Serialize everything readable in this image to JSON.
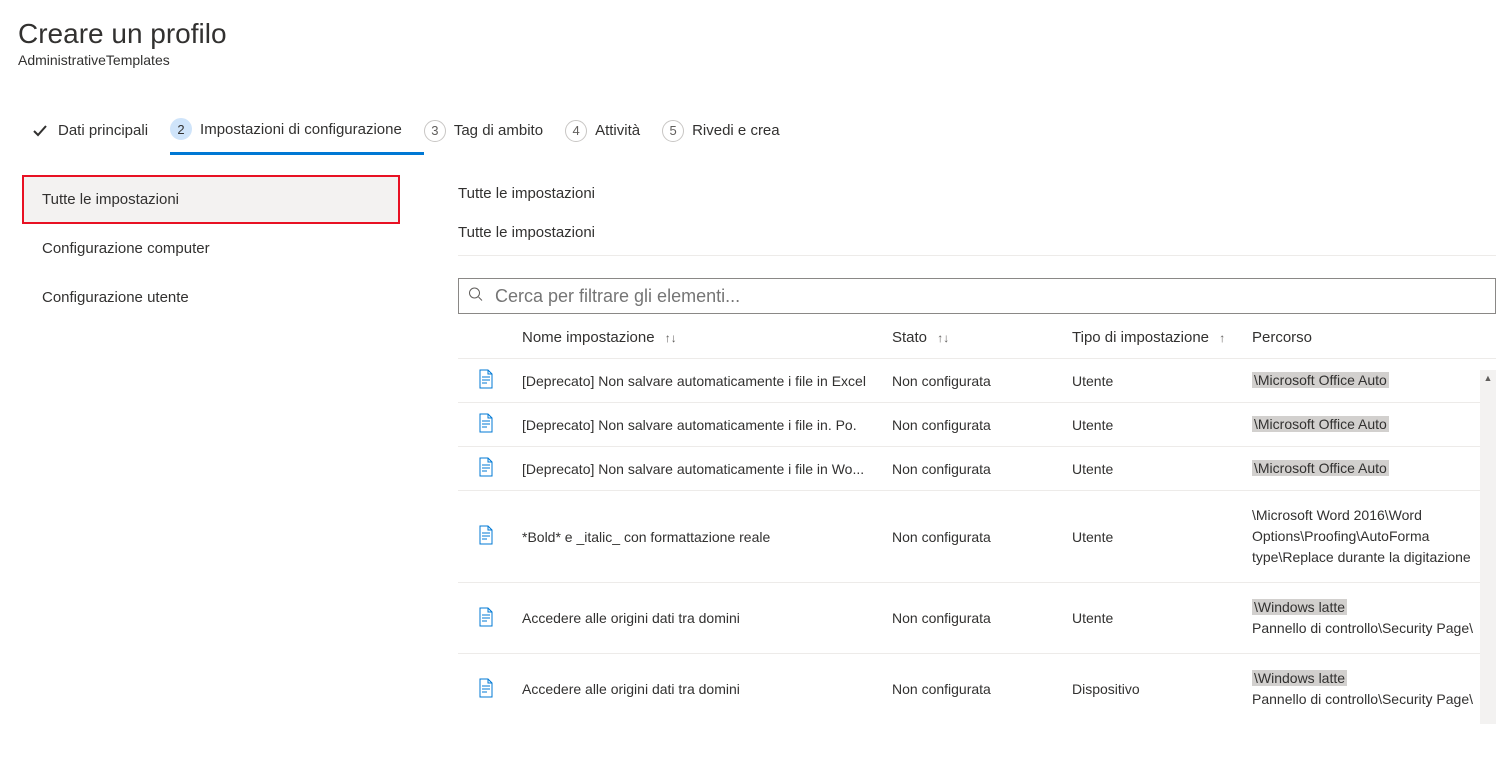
{
  "header": {
    "title": "Creare un profilo",
    "subtitle": "AdministrativeTemplates"
  },
  "steps": [
    {
      "label": "Dati principali",
      "num": "",
      "completed": true
    },
    {
      "label": "Impostazioni di configurazione",
      "num": "2",
      "active": true
    },
    {
      "label": "Tag di ambito",
      "num": "3"
    },
    {
      "label": "Attività",
      "num": "4"
    },
    {
      "label": "Rivedi e crea",
      "num": "5"
    }
  ],
  "sidebar": {
    "items": [
      {
        "label": "Tutte le impostazioni",
        "selected": true
      },
      {
        "label": "Configurazione computer"
      },
      {
        "label": "Configurazione utente"
      }
    ]
  },
  "main": {
    "title": "Tutte le impostazioni",
    "breadcrumb": "Tutte le impostazioni",
    "search_placeholder": "Cerca per filtrare gli elementi..."
  },
  "columns": {
    "name": "Nome impostazione",
    "state": "Stato",
    "type": "Tipo di impostazione",
    "path": "Percorso"
  },
  "rows": [
    {
      "name": "[Deprecato] Non salvare automaticamente i file in    Excel",
      "state": "Non configurata",
      "type": "Utente",
      "path_pre": "",
      "path_hl": "\\Microsoft Office Auto",
      "path_post": ""
    },
    {
      "name": "[Deprecato] Non salvare automaticamente i file in.  Po.",
      "state": "Non configurata",
      "type": "Utente",
      "path_pre": "",
      "path_hl": "\\Microsoft Office Auto",
      "path_post": ""
    },
    {
      "name": "[Deprecato] Non salvare automaticamente i file in Wo...",
      "state": "Non configurata",
      "type": "Utente",
      "path_pre": "",
      "path_hl": "\\Microsoft Office Auto",
      "path_post": ""
    },
    {
      "name": "*Bold* e _italic_ con formattazione reale",
      "state": "Non configurata",
      "type": "Utente",
      "path_pre": "\\Microsoft Word 2016\\Word Options\\Proofing\\AutoForma type\\Replace durante la digitazione",
      "path_hl": "",
      "path_post": "",
      "tall": true
    },
    {
      "name": "Accedere alle origini dati tra domini",
      "state": "Non configurata",
      "type": "Utente",
      "path_pre": "",
      "path_hl": "\\Windows latte",
      "path_post": "Pannello di controllo\\Security Page\\",
      "tall": true
    },
    {
      "name": "Accedere alle origini dati tra domini",
      "state": "Non configurata",
      "type": "Dispositivo",
      "path_pre": "",
      "path_hl": "\\Windows latte",
      "path_post": "Pannello di controllo\\Security Page\\",
      "tall": true
    }
  ]
}
